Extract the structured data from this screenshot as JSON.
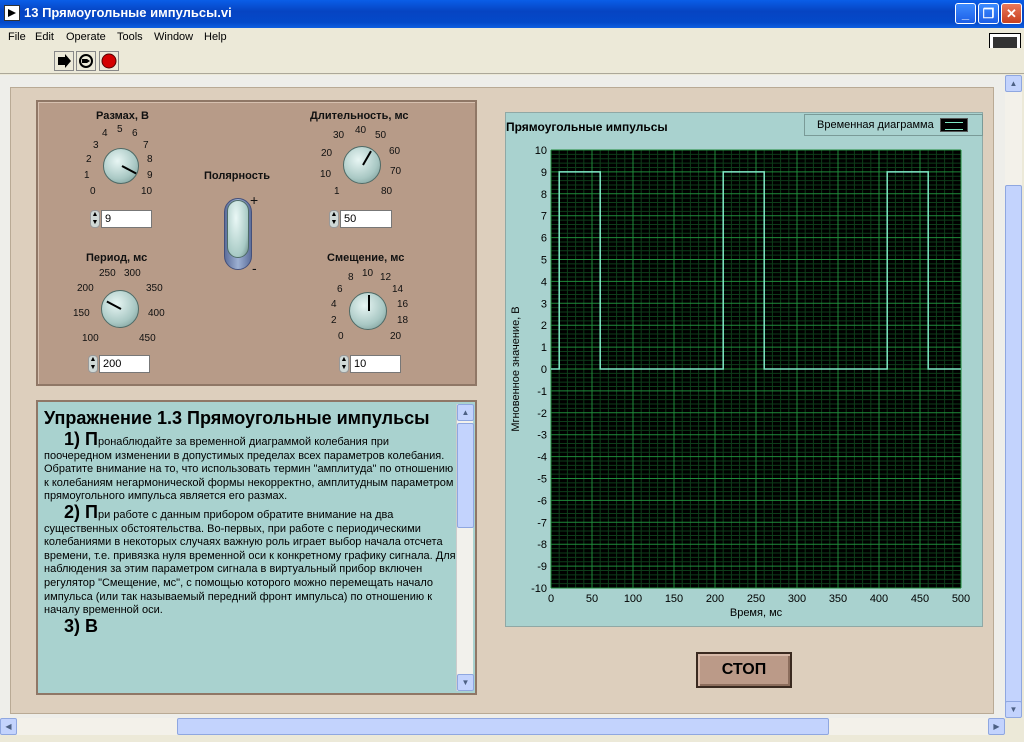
{
  "window": {
    "title": "13 Прямоугольные импульсы.vi",
    "menu": [
      "File",
      "Edit",
      "Operate",
      "Tools",
      "Window",
      "Help"
    ],
    "vi_icon_text": "1"
  },
  "controls": {
    "amplitude": {
      "label": "Размах, В",
      "ticks": [
        "0",
        "1",
        "2",
        "3",
        "4",
        "5",
        "6",
        "7",
        "8",
        "9",
        "10"
      ],
      "value": "9"
    },
    "duration": {
      "label": "Длительность, мс",
      "ticks": [
        "1",
        "10",
        "20",
        "30",
        "40",
        "50",
        "60",
        "70",
        "80"
      ],
      "value": "50"
    },
    "polarity": {
      "label": "Полярность",
      "plus": "+",
      "minus": "-"
    },
    "period": {
      "label": "Период, мс",
      "ticks": [
        "100",
        "150",
        "200",
        "250",
        "300",
        "350",
        "400",
        "450"
      ],
      "value": "200"
    },
    "offset": {
      "label": "Смещение, мс",
      "ticks": [
        "0",
        "2",
        "4",
        "6",
        "8",
        "10",
        "12",
        "14",
        "16",
        "18",
        "20"
      ],
      "value": "10"
    }
  },
  "text": {
    "heading": "Упражнение 1.3 Прямоугольные импульсы",
    "p1_num": "1) П",
    "p1": "ронаблюдайте за временной диаграммой колебания при поочередном изменении в допустимых пределах всех параметров колебания. Обратите внимание на то, что использовать термин \"амплитуда\" по отношению к колебаниям негармонической формы некорректно, амплитудным параметром прямоугольного импульса является его размах.",
    "p2_num": "2) П",
    "p2": "ри работе с данным прибором обратите внимание на два существенных обстоятельства. Во-первых, при работе с периодическими колебаниями в некоторых случаях важную роль играет выбор начала отсчета времени, т.е. привязка нуля временной оси к конкретному графику сигнала. Для наблюдения за этим параметром сигнала в виртуальный прибор включен регулятор \"Смещение, мс\", с помощью которого можно перемещать начало импульса (или так называемый передний фронт импульса) по отношению к началу временной оси.",
    "p3_num": "3) В"
  },
  "chart_data": {
    "type": "line",
    "title": "Прямоугольные импульсы",
    "legend": [
      "Временная диаграмма"
    ],
    "xlabel": "Время, мс",
    "ylabel": "Мгновенное значение, В",
    "xlim": [
      0,
      500
    ],
    "ylim": [
      -10,
      10
    ],
    "xticks": [
      0,
      50,
      100,
      150,
      200,
      250,
      300,
      350,
      400,
      450,
      500
    ],
    "yticks": [
      -10,
      -9,
      -8,
      -7,
      -6,
      -5,
      -4,
      -3,
      -2,
      -1,
      0,
      1,
      2,
      3,
      4,
      5,
      6,
      7,
      8,
      9,
      10
    ],
    "grid": true,
    "series": [
      {
        "name": "Временная диаграмма",
        "color": "#7fe9c5",
        "x": [
          0,
          10,
          10,
          60,
          60,
          210,
          210,
          260,
          260,
          410,
          410,
          460,
          460,
          500
        ],
        "y": [
          0,
          0,
          9,
          9,
          0,
          0,
          9,
          9,
          0,
          0,
          9,
          9,
          0,
          0
        ]
      }
    ]
  },
  "buttons": {
    "stop": "СТОП"
  },
  "colors": {
    "plot_bg": "#000000",
    "grid_major": "#1f8a3a",
    "grid_minor": "#0e3d1a",
    "trace": "#7fe9c5",
    "panel": "#ddcfbd",
    "control_box": "#b79b88",
    "text_box": "#a9d2cf"
  }
}
